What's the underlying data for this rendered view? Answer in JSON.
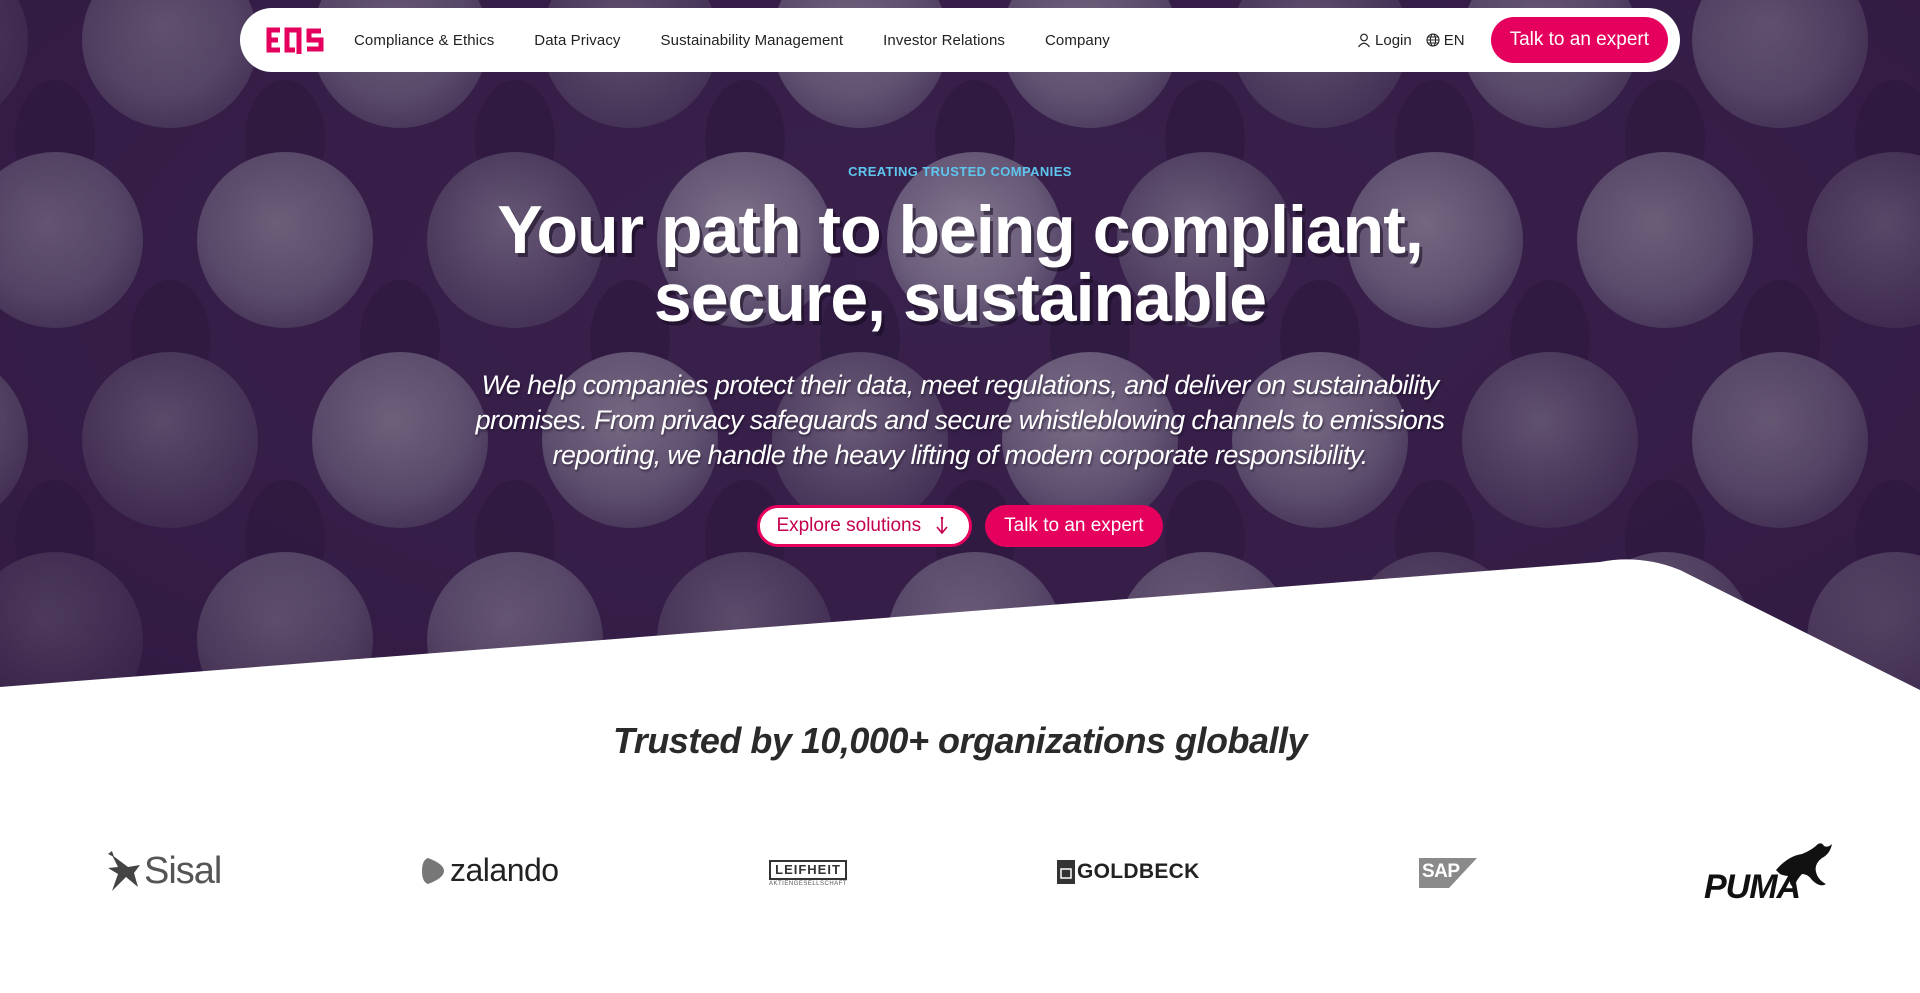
{
  "brand": {
    "logo_text": "eqs",
    "accent": "#e4005c"
  },
  "nav": {
    "links": [
      "Compliance & Ethics",
      "Data Privacy",
      "Sustainability Management",
      "Investor Relations",
      "Company"
    ],
    "login_label": "Login",
    "language_label": "EN",
    "cta_label": "Talk to an expert"
  },
  "hero": {
    "eyebrow": "CREATING TRUSTED COMPANIES",
    "headline_line1": "Your path to being compliant,",
    "headline_line2": "secure, sustainable",
    "subhead": "We help companies protect their data, meet regulations, and deliver on sustainability promises. From privacy safeguards and secure whistleblowing channels to emissions reporting, we handle the heavy lifting of modern corporate responsibility.",
    "explore_label": "Explore solutions",
    "expert_label": "Talk to an expert"
  },
  "trust": {
    "heading": "Trusted by 10,000+ organizations globally",
    "logos": [
      "Sisal",
      "zalando",
      "LEIFHEIT",
      "GOLDBECK",
      "SAP",
      "PUMA"
    ],
    "leifheit_tagline": "AKTIENGESELLSCHAFT"
  },
  "colors": {
    "hero_bg": "#3c2350",
    "eyebrow": "#5ec6ef",
    "button": "#e4005c"
  }
}
